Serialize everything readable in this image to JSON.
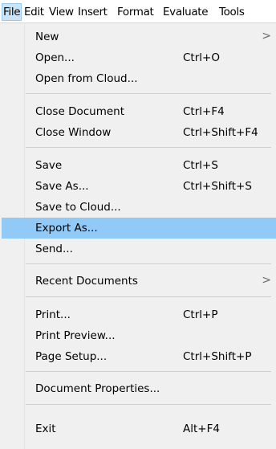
{
  "menubar": {
    "items": [
      "File",
      "Edit",
      "View",
      "Insert",
      "Format",
      "Evaluate",
      "Tools"
    ]
  },
  "file_menu": {
    "items": [
      {
        "label": "New",
        "shortcut": "",
        "submenu": true
      },
      {
        "label": "Open...",
        "shortcut": "Ctrl+O"
      },
      {
        "label": "Open from Cloud...",
        "shortcut": ""
      },
      {
        "label": "Close Document",
        "shortcut": "Ctrl+F4"
      },
      {
        "label": "Close Window",
        "shortcut": "Ctrl+Shift+F4"
      },
      {
        "label": "Save",
        "shortcut": "Ctrl+S"
      },
      {
        "label": "Save As...",
        "shortcut": "Ctrl+Shift+S"
      },
      {
        "label": "Save to Cloud...",
        "shortcut": ""
      },
      {
        "label": "Export As...",
        "shortcut": "",
        "highlighted": true
      },
      {
        "label": "Send...",
        "shortcut": ""
      },
      {
        "label": "Recent Documents",
        "shortcut": "",
        "submenu": true
      },
      {
        "label": "Print...",
        "shortcut": "Ctrl+P"
      },
      {
        "label": "Print Preview...",
        "shortcut": ""
      },
      {
        "label": "Page Setup...",
        "shortcut": "Ctrl+Shift+P"
      },
      {
        "label": "Document Properties...",
        "shortcut": ""
      },
      {
        "label": "Exit",
        "shortcut": "Alt+F4"
      }
    ],
    "submenu_arrow": ">"
  },
  "colors": {
    "menu_background": "#f0f0f0",
    "highlight": "#91c9f7",
    "menubar_active": "#cce4f7"
  }
}
